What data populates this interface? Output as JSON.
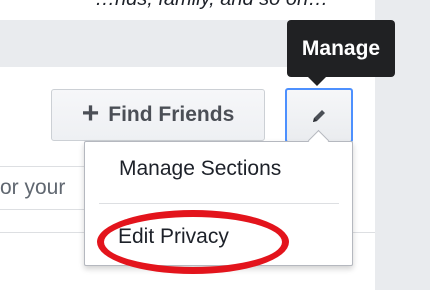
{
  "caption": {
    "text": "…nds, family, and so on…"
  },
  "toolbar": {
    "find_friends_label": "Find Friends",
    "find_friends_icon": "plus-icon",
    "edit_icon": "pencil-icon"
  },
  "tooltip": {
    "text": "Manage"
  },
  "composer": {
    "placeholder_fragment": "or your"
  },
  "dropdown": {
    "items": [
      {
        "label": "Manage Sections"
      },
      {
        "label": "Edit Privacy"
      }
    ]
  },
  "annotation": {
    "highlight_color": "#e3141c",
    "highlight_target": "Edit Privacy"
  },
  "colors": {
    "page_bg": "#e9ebee",
    "tooltip_bg": "#202123",
    "focus_border": "#4d90fe"
  }
}
